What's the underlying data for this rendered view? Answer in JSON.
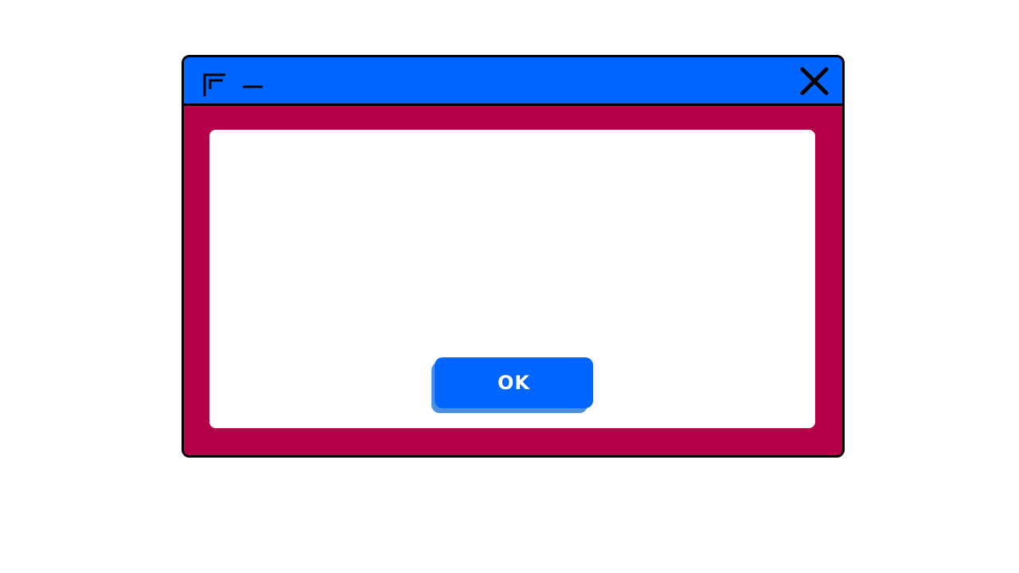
{
  "colors": {
    "page_background": "#ffffff",
    "titlebar": "#0066ff",
    "window_body": "#b5004a",
    "window_border": "#000000",
    "content_panel": "#ffffff",
    "ok_button": "#0066ff",
    "ok_button_shadow": "#4a8fe0",
    "ok_label": "#ffffff"
  },
  "titlebar": {
    "icons": [
      "restore-icon",
      "minimize-icon",
      "close-icon"
    ]
  },
  "dialog": {
    "ok_label": "OK"
  }
}
